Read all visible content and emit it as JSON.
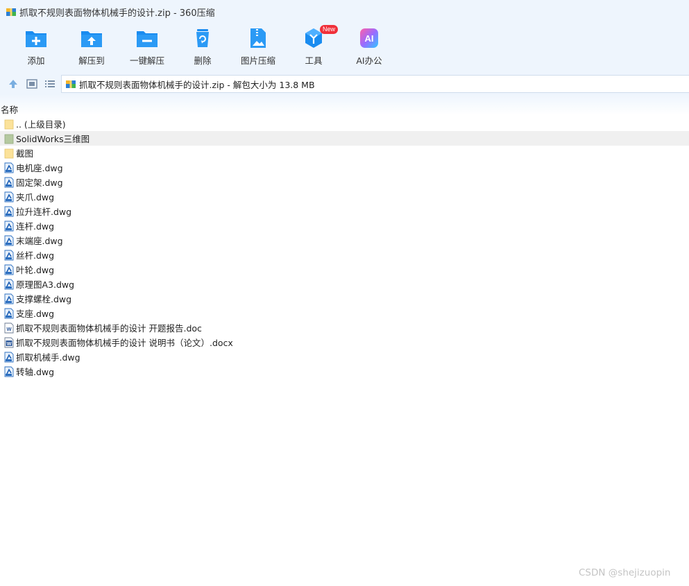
{
  "window": {
    "title": "抓取不规则表面物体机械手的设计.zip - 360压缩"
  },
  "toolbar": {
    "buttons": [
      {
        "label": "添加",
        "icon": "add-folder-icon"
      },
      {
        "label": "解压到",
        "icon": "extract-to-icon"
      },
      {
        "label": "一键解压",
        "icon": "one-click-extract-icon"
      },
      {
        "label": "删除",
        "icon": "recycle-bin-icon"
      },
      {
        "label": "图片压缩",
        "icon": "image-compress-icon"
      },
      {
        "label": "工具",
        "icon": "tools-icon",
        "badge": "New"
      },
      {
        "label": "AI办公",
        "icon": "ai-office-icon",
        "icon_text": "AI"
      }
    ]
  },
  "address": {
    "text": "抓取不规则表面物体机械手的设计.zip - 解包大小为 13.8 MB"
  },
  "columns": {
    "name": "名称"
  },
  "files": [
    {
      "name": ".. (上级目录)",
      "type": "folder"
    },
    {
      "name": "SolidWorks三维图",
      "type": "folder-green"
    },
    {
      "name": "截图",
      "type": "folder"
    },
    {
      "name": "电机座.dwg",
      "type": "dwg"
    },
    {
      "name": "固定架.dwg",
      "type": "dwg"
    },
    {
      "name": "夹爪.dwg",
      "type": "dwg"
    },
    {
      "name": "拉升连杆.dwg",
      "type": "dwg"
    },
    {
      "name": "连杆.dwg",
      "type": "dwg"
    },
    {
      "name": "末端座.dwg",
      "type": "dwg"
    },
    {
      "name": "丝杆.dwg",
      "type": "dwg"
    },
    {
      "name": "叶轮.dwg",
      "type": "dwg"
    },
    {
      "name": "原理图A3.dwg",
      "type": "dwg"
    },
    {
      "name": "支撑螺栓.dwg",
      "type": "dwg"
    },
    {
      "name": "支座.dwg",
      "type": "dwg"
    },
    {
      "name": "抓取不规则表面物体机械手的设计 开题报告.doc",
      "type": "doc"
    },
    {
      "name": "抓取不规则表面物体机械手的设计 说明书（论文）.docx",
      "type": "docx"
    },
    {
      "name": "抓取机械手.dwg",
      "type": "dwg"
    },
    {
      "name": "转轴.dwg",
      "type": "dwg"
    }
  ],
  "selected_index": 1,
  "watermark": "CSDN @shejizuopin",
  "colors": {
    "chrome_bg": "#eef5fd",
    "icon_blue": "#1a8cf0",
    "folder_yellow": "#fbe29a",
    "folder_green": "#b5c9a0",
    "badge_red": "#f0303a",
    "selected_row": "#f0f0f0"
  }
}
